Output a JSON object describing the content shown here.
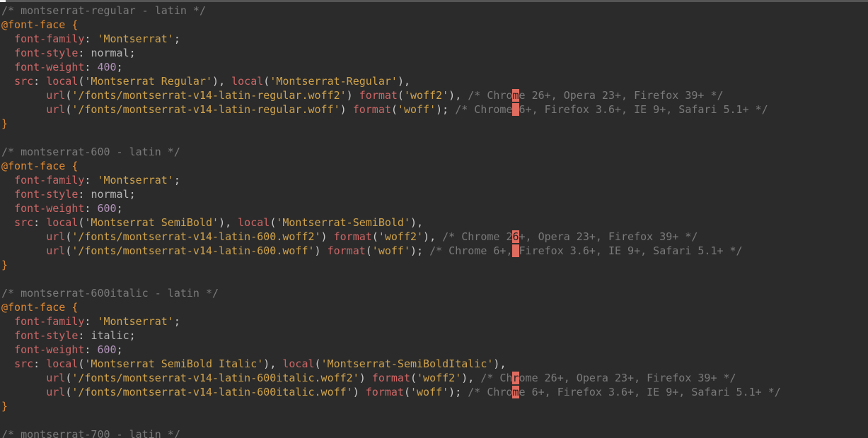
{
  "blocks": [
    {
      "section_comment": "/* montserrat-regular - latin */",
      "font_family": "'Montserrat'",
      "font_style": "normal",
      "font_weight": "400",
      "local1": "'Montserrat Regular'",
      "local2": "'Montserrat-Regular'",
      "url_woff2": "'/fonts/montserrat-v14-latin-regular.woff2'",
      "fmt_woff2": "'woff2'",
      "url_woff": "'/fonts/montserrat-v14-latin-regular.woff'",
      "fmt_woff": "'woff'",
      "cmt_woff2_a": "/* Chro",
      "cmt_woff2_hl": "m",
      "cmt_woff2_b": "e 26+, Opera 23+, Firefox 39+ */",
      "cmt_woff_a": "/* Chrome",
      "cmt_woff_hl": " ",
      "cmt_woff_b": "6+, Firefox 3.6+, IE 9+, Safari 5.1+ */"
    },
    {
      "section_comment": "/* montserrat-600 - latin */",
      "font_family": "'Montserrat'",
      "font_style": "normal",
      "font_weight": "600",
      "local1": "'Montserrat SemiBold'",
      "local2": "'Montserrat-SemiBold'",
      "url_woff2": "'/fonts/montserrat-v14-latin-600.woff2'",
      "fmt_woff2": "'woff2'",
      "url_woff": "'/fonts/montserrat-v14-latin-600.woff'",
      "fmt_woff": "'woff'",
      "cmt_woff2_a": "/* Chrome 2",
      "cmt_woff2_hl": "6",
      "cmt_woff2_b": "+, Opera 23+, Firefox 39+ */",
      "cmt_woff_a": "/* Chrome 6+,",
      "cmt_woff_hl": " ",
      "cmt_woff_b": "Firefox 3.6+, IE 9+, Safari 5.1+ */"
    },
    {
      "section_comment": "/* montserrat-600italic - latin */",
      "font_family": "'Montserrat'",
      "font_style": "italic",
      "font_weight": "600",
      "local1": "'Montserrat SemiBold Italic'",
      "local2": "'Montserrat-SemiBoldItalic'",
      "url_woff2": "'/fonts/montserrat-v14-latin-600italic.woff2'",
      "fmt_woff2": "'woff2'",
      "url_woff": "'/fonts/montserrat-v14-latin-600italic.woff'",
      "fmt_woff": "'woff'",
      "cmt_woff2_a": "/* Ch",
      "cmt_woff2_hl": "r",
      "cmt_woff2_b": "ome 26+, Opera 23+, Firefox 39+ */",
      "cmt_woff_a": "/* Chro",
      "cmt_woff_hl": "m",
      "cmt_woff_b": "e 6+, Firefox 3.6+, IE 9+, Safari 5.1+ */"
    }
  ],
  "trailing_comment": "/* montserrat-700 - latin */",
  "tokens": {
    "at_rule": "@font-face",
    "lbrace": " {",
    "rbrace": "}",
    "font_family_kw": "font-family",
    "font_style_kw": "font-style",
    "font_weight_kw": "font-weight",
    "src_kw": "src",
    "local_fn": "local",
    "url_fn": "url",
    "format_fn": "format",
    "colon_sp": ": ",
    "comma_sp": ", ",
    "comma": ",",
    "semi": ";",
    "lp": "(",
    "rp": ")",
    "indent1": "  ",
    "indent_cont": "       "
  }
}
